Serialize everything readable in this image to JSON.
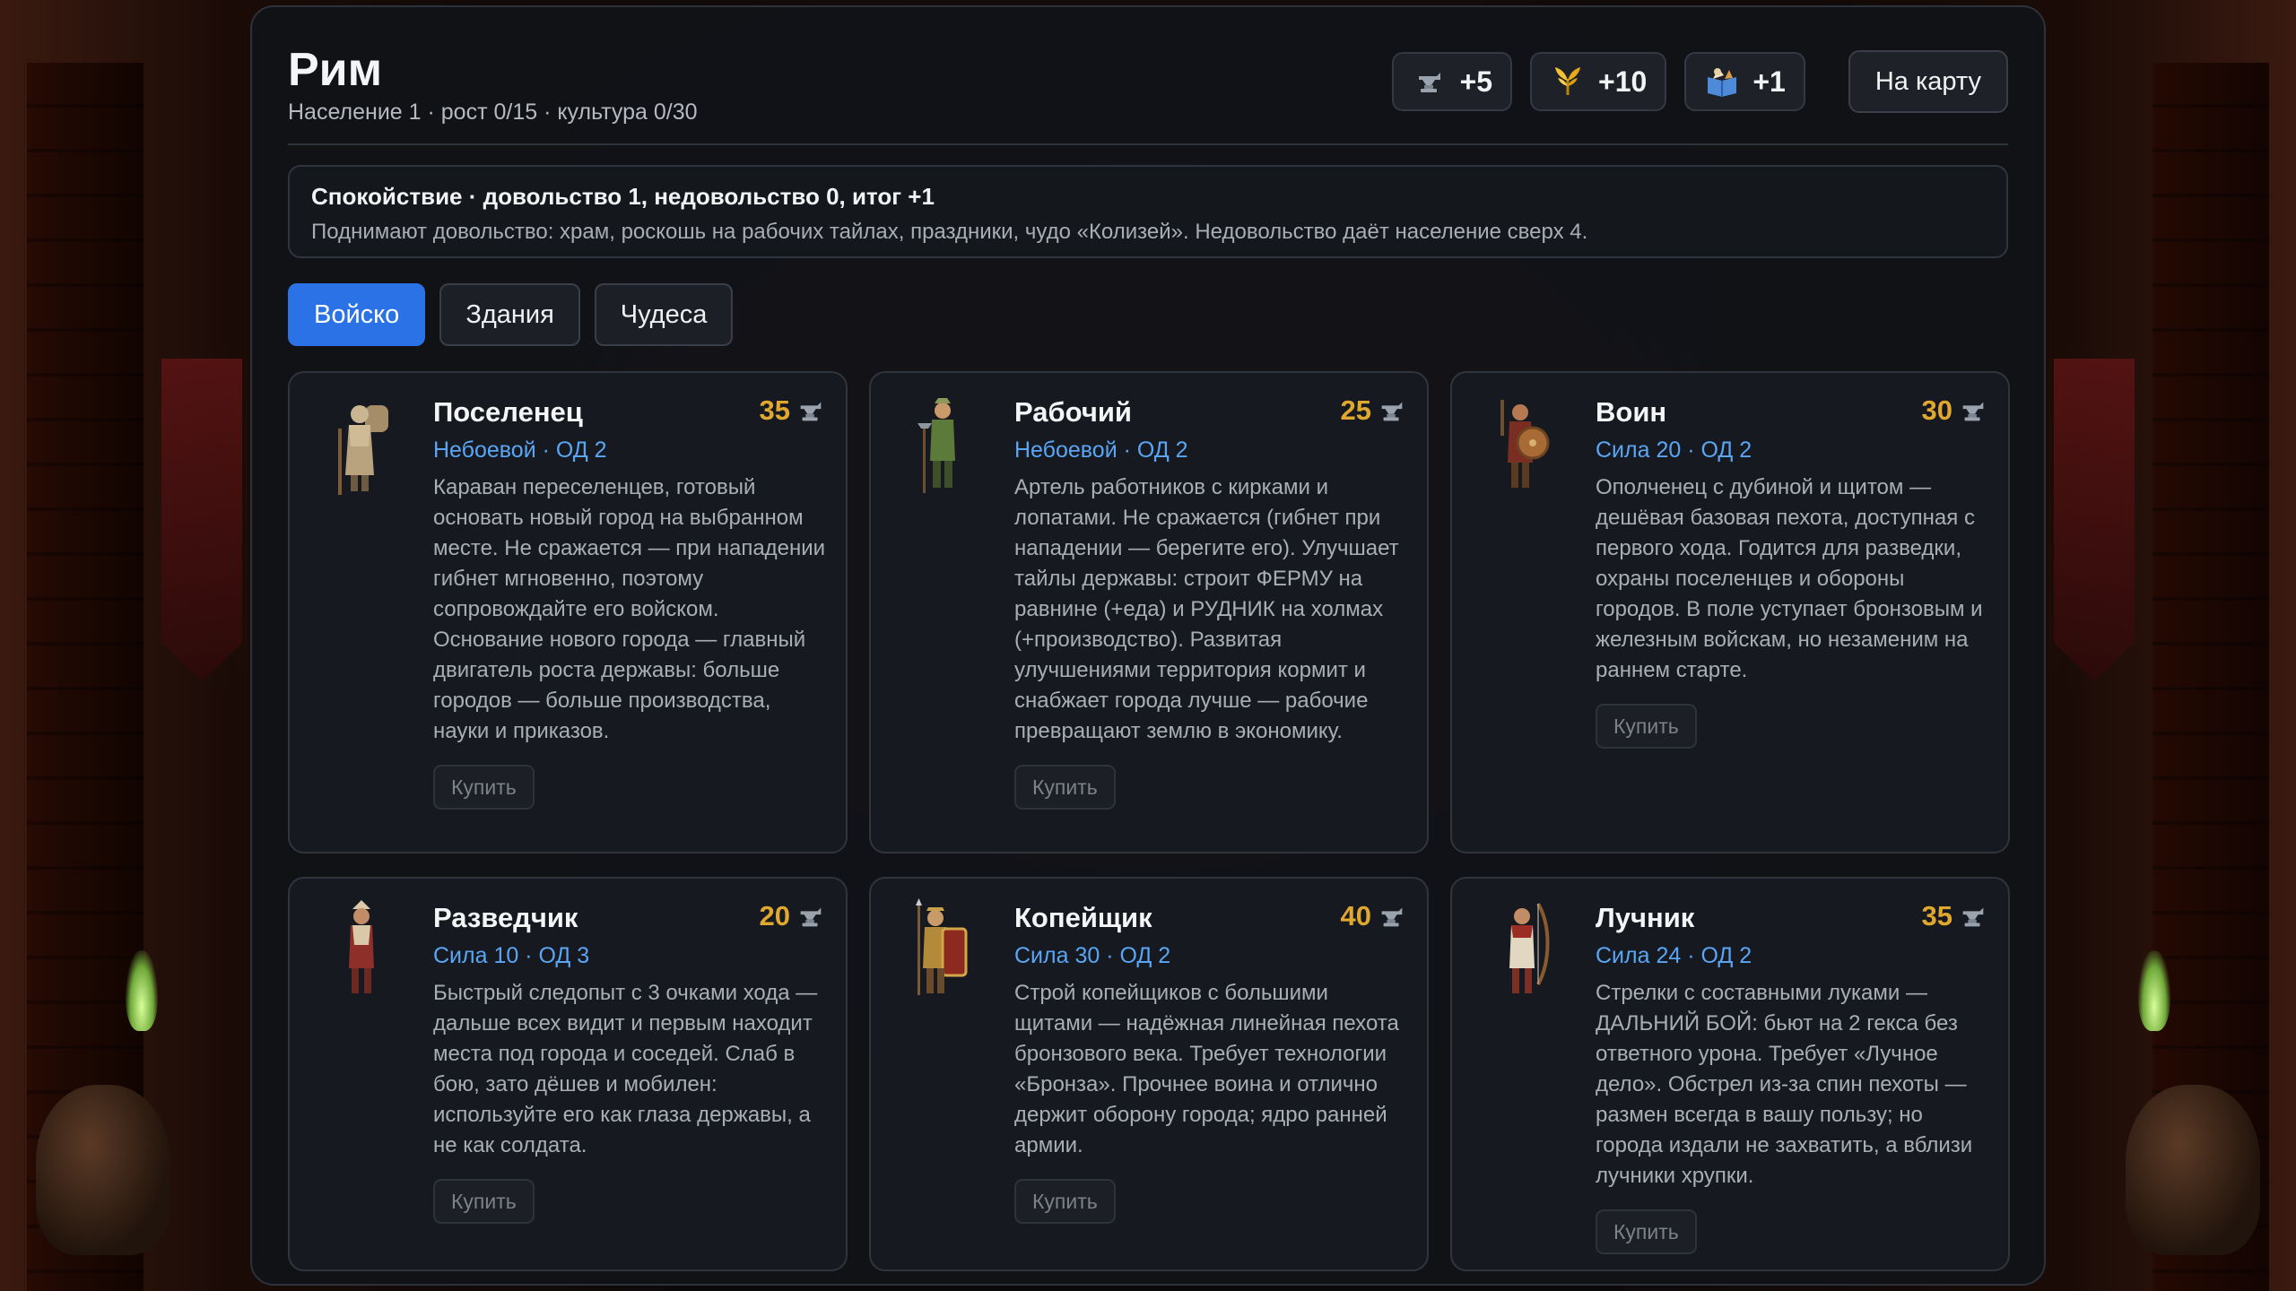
{
  "city": {
    "name": "Рим",
    "stats": "Население 1 · рост 0/15 · культура 0/30"
  },
  "yields": [
    {
      "icon": "production-anvil-icon",
      "value": "+5"
    },
    {
      "icon": "laurel-gold-icon",
      "value": "+10"
    },
    {
      "icon": "science-book-icon",
      "value": "+1"
    }
  ],
  "map_button": "На карту",
  "mood": {
    "title": "Спокойствие · довольство 1, недовольство 0, итог +1",
    "description": "Поднимают довольство: храм, роскошь на рабочих тайлах, праздники, чудо «Колизей». Недовольство даёт население сверх 4."
  },
  "tabs": [
    {
      "label": "Войско",
      "active": true
    },
    {
      "label": "Здания",
      "active": false
    },
    {
      "label": "Чудеса",
      "active": false
    }
  ],
  "units": [
    {
      "name": "Поселенец",
      "cost": "35",
      "stats": "Небоевой · ОД 2",
      "description": "Караван переселенцев, готовый основать новый город на выбранном месте. Не сражается — при нападении гибнет мгновенно, поэтому сопровождайте его войском. Основание нового города — главный двигатель роста державы: больше городов — больше производства, науки и приказов.",
      "buy": "Купить",
      "portrait": "settler-portrait-icon"
    },
    {
      "name": "Рабочий",
      "cost": "25",
      "stats": "Небоевой · ОД 2",
      "description": "Артель работников с кирками и лопатами. Не сражается (гибнет при нападении — берегите его). Улучшает тайлы державы: строит ФЕРМУ на равнине (+еда) и РУДНИК на холмах (+производство). Развитая улучшениями территория кормит и снабжает города лучше — рабочие превращают землю в экономику.",
      "buy": "Купить",
      "portrait": "worker-portrait-icon"
    },
    {
      "name": "Воин",
      "cost": "30",
      "stats": "Сила 20 · ОД 2",
      "description": "Ополченец с дубиной и щитом — дешёвая базовая пехота, доступная с первого хода. Годится для разведки, охраны поселенцев и обороны городов. В поле уступает бронзовым и железным войскам, но незаменим на раннем старте.",
      "buy": "Купить",
      "portrait": "warrior-portrait-icon"
    },
    {
      "name": "Разведчик",
      "cost": "20",
      "stats": "Сила 10 · ОД 3",
      "description": "Быстрый следопыт с 3 очками хода — дальше всех видит и первым находит места под города и соседей. Слаб в бою, зато дёшев и мобилен: используйте его как глаза державы, а не как солдата.",
      "buy": "Купить",
      "portrait": "scout-portrait-icon"
    },
    {
      "name": "Копейщик",
      "cost": "40",
      "stats": "Сила 30 · ОД 2",
      "description": "Строй копейщиков с большими щитами — надёжная линейная пехота бронзового века. Требует технологии «Бронза». Прочнее воина и отлично держит оборону города; ядро ранней армии.",
      "buy": "Купить",
      "portrait": "spearman-portrait-icon"
    },
    {
      "name": "Лучник",
      "cost": "35",
      "stats": "Сила 24 · ОД 2",
      "description": "Стрелки с составными луками — ДАЛЬНИЙ БОЙ: бьют на 2 гекса без ответного урона. Требует «Лучное дело». Обстрел из-за спин пехоты — размен всегда в вашу пользу; но города издали не захватить, а вблизи лучники хрупки.",
      "buy": "Купить",
      "portrait": "archer-portrait-icon"
    }
  ],
  "colors": {
    "accent": "#2a72e6",
    "cost": "#e0a82e",
    "stats": "#5aa6f5"
  }
}
